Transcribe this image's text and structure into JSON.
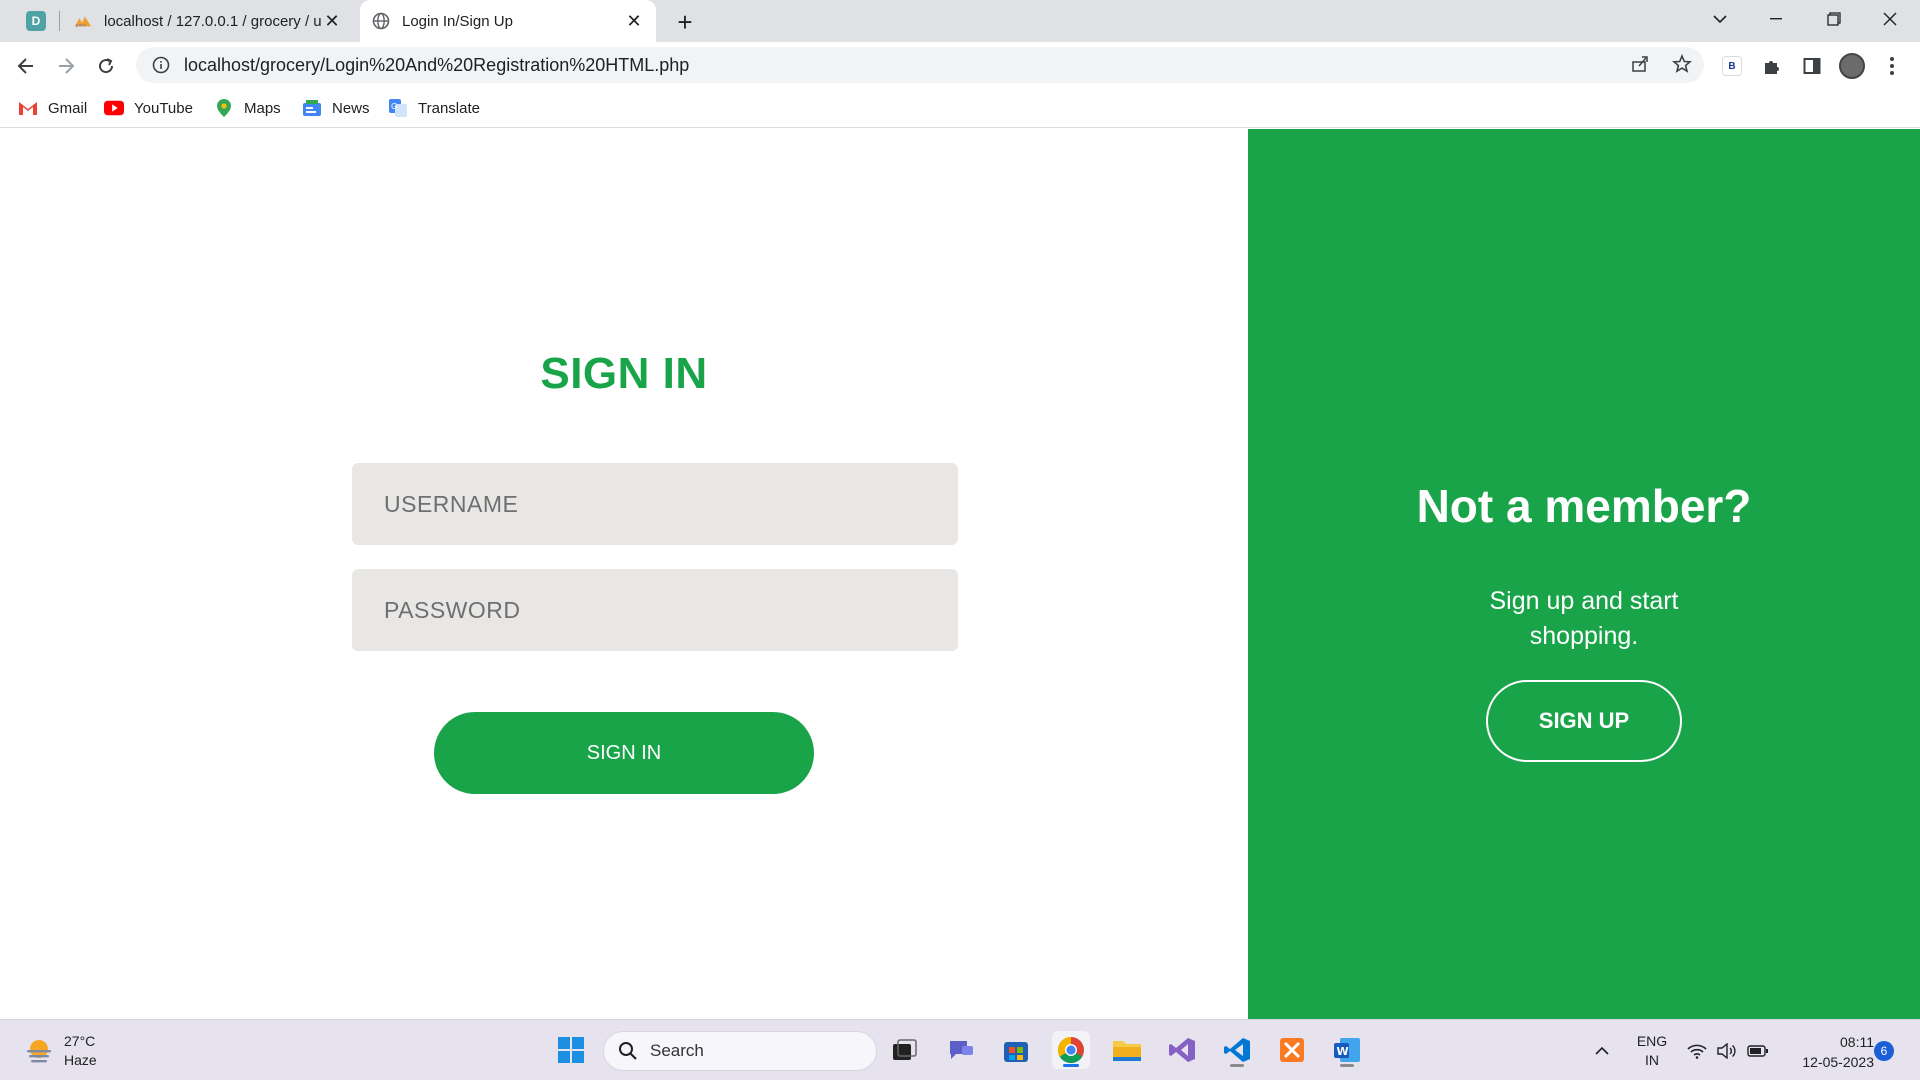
{
  "browser": {
    "tabs": [
      {
        "title": "localhost / 127.0.0.1 / grocery / u",
        "active": false
      },
      {
        "title": "Login In/Sign Up",
        "active": true
      }
    ],
    "address": "localhost/grocery/Login%20And%20Registration%20HTML.php",
    "extension_badge": "B",
    "bookmarks": [
      "Gmail",
      "YouTube",
      "Maps",
      "News",
      "Translate"
    ]
  },
  "signin": {
    "title": "SIGN IN",
    "username_placeholder": "USERNAME",
    "password_placeholder": "PASSWORD",
    "button_label": "SIGN IN"
  },
  "signup_panel": {
    "title": "Not a member?",
    "subtitle": "Sign up and start shopping.",
    "button_label": "SIGN UP"
  },
  "taskbar": {
    "weather_temp": "27°C",
    "weather_desc": "Haze",
    "search_label": "Search",
    "lang_line1": "ENG",
    "lang_line2": "IN",
    "time": "08:11",
    "date": "12-05-2023",
    "notifications": "6"
  },
  "colors": {
    "brand_green": "#19a449",
    "field_bg": "#e8e7e6"
  }
}
